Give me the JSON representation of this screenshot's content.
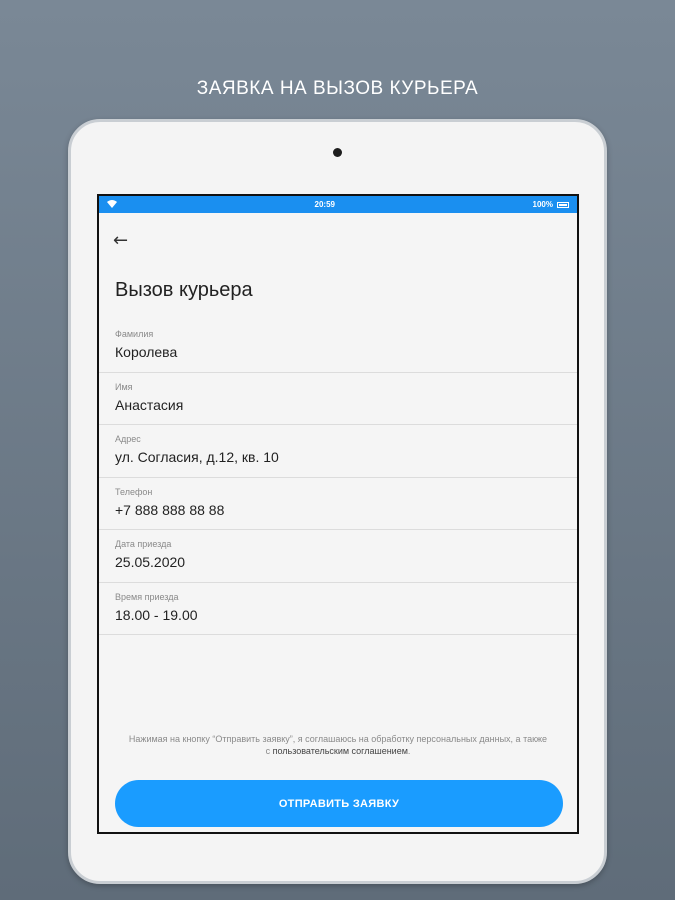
{
  "promo_title": "ЗАЯВКА НА ВЫЗОВ КУРЬЕРА",
  "status_bar": {
    "time": "20:59",
    "battery": "100%"
  },
  "back_glyph": "←",
  "page_title": "Вызов курьера",
  "fields": [
    {
      "label": "Фамилия",
      "value": "Королева"
    },
    {
      "label": "Имя",
      "value": "Анастасия"
    },
    {
      "label": "Адрес",
      "value": "ул. Согласия, д.12, кв. 10"
    },
    {
      "label": "Телефон",
      "value": "+7 888 888 88 88"
    },
    {
      "label": "Дата приезда",
      "value": "25.05.2020"
    },
    {
      "label": "Время приезда",
      "value": "18.00 - 19.00"
    }
  ],
  "consent": {
    "text_before": "Нажимая на кнопку “Отправить заявку”, я соглашаюсь на обработку персональных данных, а также с ",
    "link": "пользовательским соглашением",
    "text_after": "."
  },
  "submit_label": "ОТПРАВИТЬ ЗАЯВКУ",
  "colors": {
    "accent": "#1a9cff",
    "status_bar": "#1a8ff0"
  }
}
